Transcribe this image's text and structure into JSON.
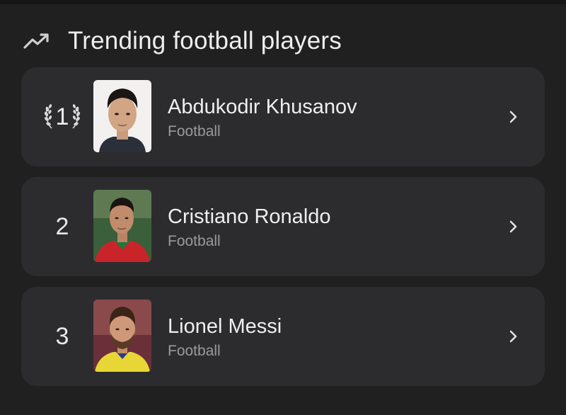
{
  "header": {
    "icon": "trending-up-icon",
    "title": "Trending football players"
  },
  "players": [
    {
      "rank": "1",
      "rank_style": "laurel",
      "name": "Abdukodir Khusanov",
      "sport": "Football",
      "photo": "player-photo",
      "chevron": "chevron-right-icon"
    },
    {
      "rank": "2",
      "rank_style": "plain",
      "name": "Cristiano Ronaldo",
      "sport": "Football",
      "photo": "player-photo",
      "chevron": "chevron-right-icon"
    },
    {
      "rank": "3",
      "rank_style": "plain",
      "name": "Lionel Messi",
      "sport": "Football",
      "photo": "player-photo",
      "chevron": "chevron-right-icon"
    }
  ],
  "colors": {
    "background": "#202021",
    "card": "#2c2c2e",
    "text_primary": "#efefef",
    "text_secondary": "#9a9a9c"
  }
}
